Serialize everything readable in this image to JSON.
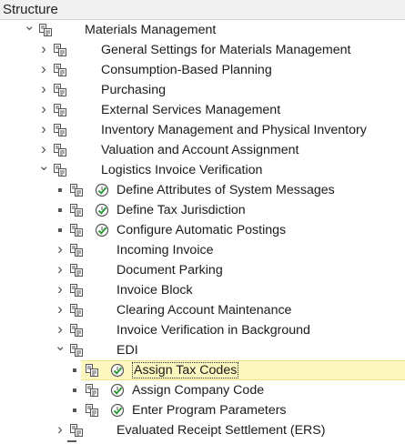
{
  "header": {
    "title": "Structure"
  },
  "rows": [
    {
      "label": "Materials Management",
      "toggle": "v",
      "action": false,
      "level": 0
    },
    {
      "label": "General Settings for Materials Management",
      "toggle": ">",
      "action": false,
      "level": 1
    },
    {
      "label": "Consumption-Based Planning",
      "toggle": ">",
      "action": false,
      "level": 1
    },
    {
      "label": "Purchasing",
      "toggle": ">",
      "action": false,
      "level": 1
    },
    {
      "label": "External Services Management",
      "toggle": ">",
      "action": false,
      "level": 1
    },
    {
      "label": "Inventory Management and Physical Inventory",
      "toggle": ">",
      "action": false,
      "level": 1
    },
    {
      "label": "Valuation and Account Assignment",
      "toggle": ">",
      "action": false,
      "level": 1
    },
    {
      "label": "Logistics Invoice Verification",
      "toggle": "v",
      "action": false,
      "level": 1
    },
    {
      "label": "Define Attributes of System Messages",
      "toggle": "",
      "action": true,
      "level": 2
    },
    {
      "label": "Define Tax Jurisdiction",
      "toggle": "",
      "action": true,
      "level": 2
    },
    {
      "label": "Configure Automatic Postings",
      "toggle": "",
      "action": true,
      "level": 2
    },
    {
      "label": "Incoming Invoice",
      "toggle": ">",
      "action": false,
      "level": 2
    },
    {
      "label": "Document Parking",
      "toggle": ">",
      "action": false,
      "level": 2
    },
    {
      "label": "Invoice Block",
      "toggle": ">",
      "action": false,
      "level": 2
    },
    {
      "label": "Clearing Account Maintenance",
      "toggle": ">",
      "action": false,
      "level": 2
    },
    {
      "label": "Invoice Verification in Background",
      "toggle": ">",
      "action": false,
      "level": 2
    },
    {
      "label": "EDI",
      "toggle": "v",
      "action": false,
      "level": 2
    },
    {
      "label": "Assign Tax Codes",
      "toggle": "",
      "action": true,
      "level": 3,
      "selected": true
    },
    {
      "label": "Assign Company Code",
      "toggle": "",
      "action": true,
      "level": 3
    },
    {
      "label": "Enter Program Parameters",
      "toggle": "",
      "action": true,
      "level": 3
    },
    {
      "label": "Evaluated Receipt Settlement (ERS)",
      "toggle": ">",
      "action": false,
      "level": 2
    }
  ],
  "icons": {
    "node": "document-tree-icon",
    "activity": "clock-check-icon",
    "expand": "chevron-right-icon",
    "collapse": "chevron-down-icon"
  },
  "colors": {
    "selected_bg": "#fdf7c0",
    "check_green": "#2e9a3a",
    "icon_gray": "#555555"
  }
}
